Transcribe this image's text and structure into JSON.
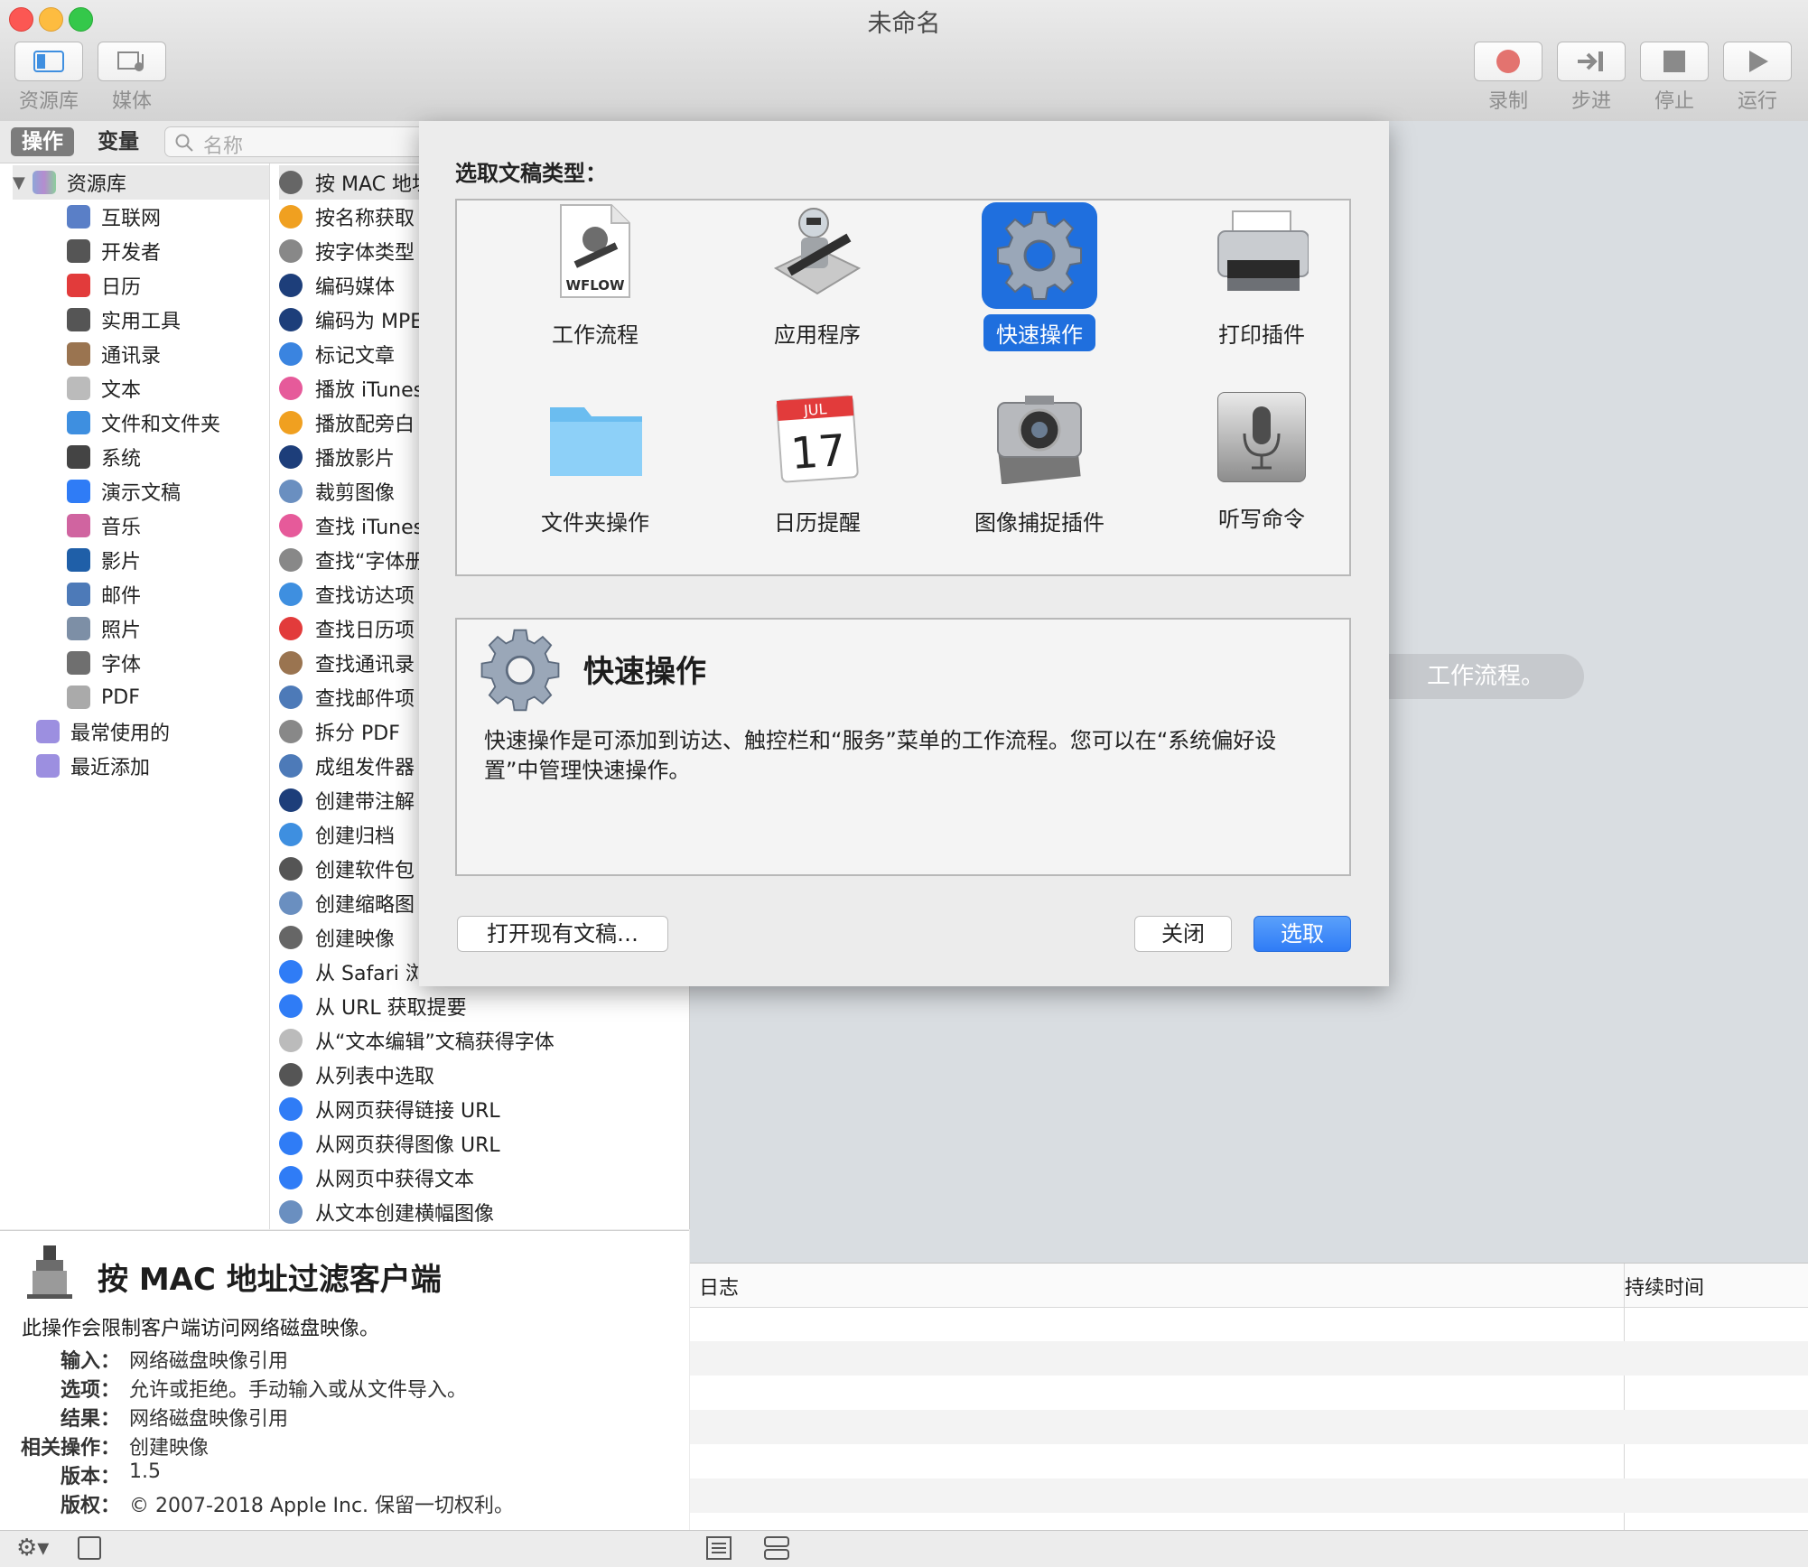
{
  "window": {
    "title": "未命名"
  },
  "toolbar": {
    "left": [
      {
        "label": "资源库",
        "icon": "library-icon"
      },
      {
        "label": "媒体",
        "icon": "media-icon"
      }
    ],
    "right": [
      {
        "label": "录制",
        "icon": "record-icon"
      },
      {
        "label": "步进",
        "icon": "step-icon"
      },
      {
        "label": "停止",
        "icon": "stop-icon"
      },
      {
        "label": "运行",
        "icon": "run-icon"
      }
    ]
  },
  "library": {
    "tabs": [
      "操作",
      "变量"
    ],
    "search_placeholder": "名称",
    "root": "资源库",
    "categories": [
      "互联网",
      "开发者",
      "日历",
      "实用工具",
      "通讯录",
      "文本",
      "文件和文件夹",
      "系统",
      "演示文稿",
      "音乐",
      "影片",
      "邮件",
      "照片",
      "字体",
      "PDF"
    ],
    "groups": [
      "最常使用的",
      "最近添加"
    ],
    "actions": [
      "按 MAC 地址",
      "按名称获取",
      "按字体类型",
      "编码媒体",
      "编码为 MPEG",
      "标记文章",
      "播放 iTunes",
      "播放配旁白",
      "播放影片",
      "裁剪图像",
      "查找 iTunes",
      "查找“字体册",
      "查找访达项",
      "查找日历项",
      "查找通讯录",
      "查找邮件项",
      "拆分 PDF",
      "成组发件器",
      "创建带注解",
      "创建归档",
      "创建软件包",
      "创建缩略图",
      "创建映像",
      "从 Safari 浏",
      "从 URL 获取提要",
      "从“文本编辑”文稿获得字体",
      "从列表中选取",
      "从网页获得链接 URL",
      "从网页获得图像 URL",
      "从网页中获得文本",
      "从文本创建横幅图像"
    ]
  },
  "description": {
    "title": "按 MAC 地址过滤客户端",
    "summary": "此操作会限制客户端访问网络磁盘映像。",
    "fields": [
      {
        "key": "输入：",
        "value": "网络磁盘映像引用"
      },
      {
        "key": "选项：",
        "value": "允许或拒绝。手动输入或从文件导入。"
      },
      {
        "key": "结果：",
        "value": "网络磁盘映像引用"
      },
      {
        "key": "相关操作：",
        "value": "创建映像"
      },
      {
        "key": "版本：",
        "value": "1.5"
      },
      {
        "key": "版权：",
        "value": "© 2007-2018 Apple Inc. 保留一切权利。"
      }
    ]
  },
  "workflow": {
    "hint": "工作流程。"
  },
  "log": {
    "col_log": "日志",
    "col_duration": "持续时间"
  },
  "dialog": {
    "prompt": "选取文稿类型：",
    "types": [
      {
        "label": "工作流程",
        "icon": "workflow-document-icon",
        "badge": "WFLOW"
      },
      {
        "label": "应用程序",
        "icon": "automator-robot-icon"
      },
      {
        "label": "快速操作",
        "icon": "gear-icon",
        "selected": true
      },
      {
        "label": "打印插件",
        "icon": "printer-icon"
      },
      {
        "label": "文件夹操作",
        "icon": "folder-icon"
      },
      {
        "label": "日历提醒",
        "icon": "calendar-icon",
        "month": "JUL",
        "day": "17"
      },
      {
        "label": "图像捕捉插件",
        "icon": "camera-icon"
      },
      {
        "label": "听写命令",
        "icon": "microphone-icon"
      }
    ],
    "info_title": "快速操作",
    "info_text": "快速操作是可添加到访达、触控栏和“服务”菜单的工作流程。您可以在“系统偏好设置”中管理快速操作。",
    "open_existing": "打开现有文稿…",
    "close": "关闭",
    "choose": "选取"
  },
  "colors": {
    "accent": "#2f7cf6",
    "selected_tile": "#1f6fde"
  }
}
